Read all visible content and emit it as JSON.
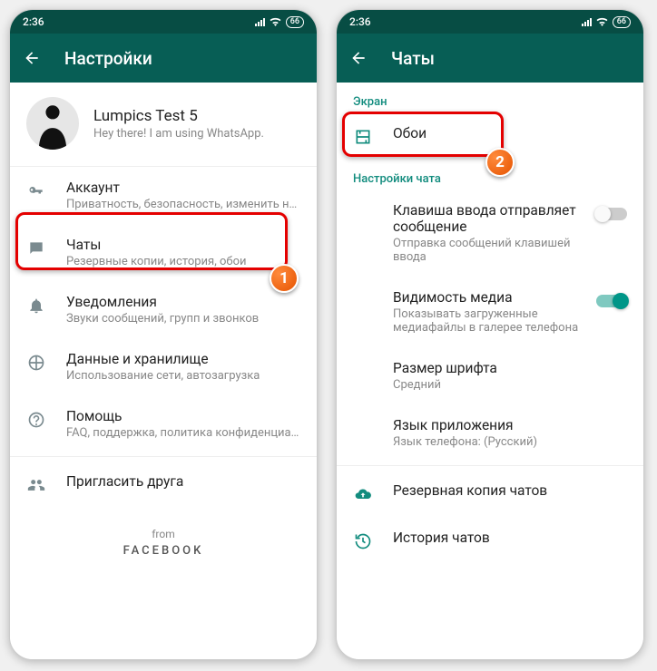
{
  "status": {
    "time": "2:36",
    "battery": "66"
  },
  "left": {
    "appbar_title": "Настройки",
    "profile": {
      "name": "Lumpics Test 5",
      "status": "Hey there! I am using WhatsApp."
    },
    "items": [
      {
        "title": "Аккаунт",
        "sub": "Приватность, безопасность, изменить номер"
      },
      {
        "title": "Чаты",
        "sub": "Резервные копии, история, обои"
      },
      {
        "title": "Уведомления",
        "sub": "Звуки сообщений, групп и звонков"
      },
      {
        "title": "Данные и хранилище",
        "sub": "Использование сети, автозагрузка"
      },
      {
        "title": "Помощь",
        "sub": "FAQ, поддержка, политика конфиденциальн..."
      },
      {
        "title": "Пригласить друга",
        "sub": ""
      }
    ],
    "footer_from": "from",
    "footer_brand": "FACEBOOK"
  },
  "right": {
    "appbar_title": "Чаты",
    "section_screen": "Экран",
    "wallpaper": "Обои",
    "section_chat": "Настройки чата",
    "items": [
      {
        "title": "Клавиша ввода отправляет сообщение",
        "sub": "Отправка сообщений клавишей ввода"
      },
      {
        "title": "Видимость медиа",
        "sub": "Показывать загруженные медиафайлы в галерее телефона"
      },
      {
        "title": "Размер шрифта",
        "sub": "Средний"
      },
      {
        "title": "Язык приложения",
        "sub": "Язык телефона: (Русский)"
      }
    ],
    "backup": "Резервная копия чатов",
    "history": "История чатов"
  },
  "badges": {
    "one": "1",
    "two": "2"
  }
}
